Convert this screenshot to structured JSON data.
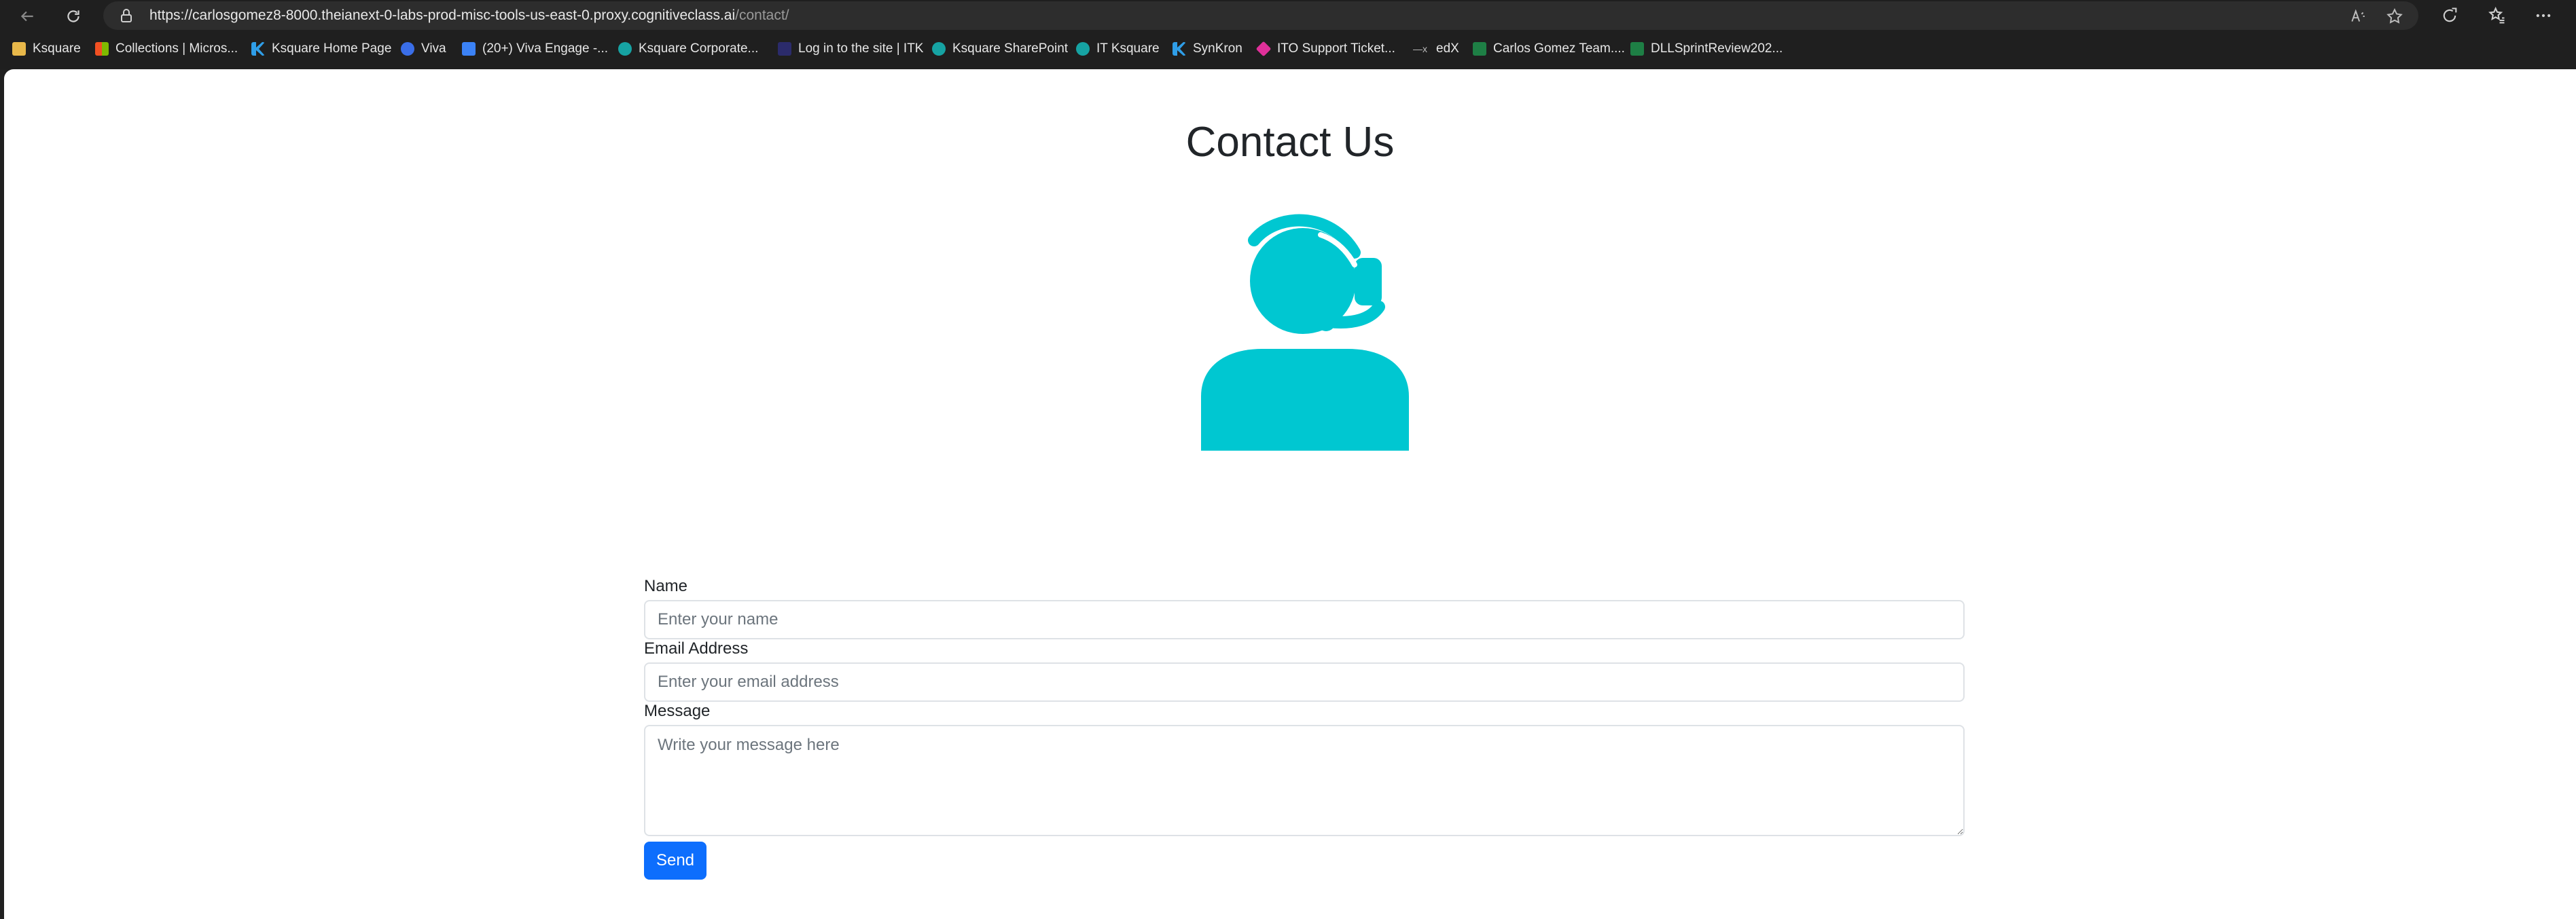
{
  "browser": {
    "url_host": "https://carlosgomez8-8000.theianext-0-labs-prod-misc-tools-us-east-0.proxy.cognitiveclass.ai",
    "url_path": "/contact/",
    "bookmarks": [
      {
        "label": "Ksquare",
        "icon": "folder-icon",
        "color": "#e8b84a"
      },
      {
        "label": "Collections | Micros...",
        "icon": "microsoft-icon",
        "color": "#f25022"
      },
      {
        "label": "Ksquare Home Page",
        "icon": "ksquare-icon",
        "color": "#2f9ee8"
      },
      {
        "label": "Viva",
        "icon": "viva-icon",
        "color": "#3a6ee8"
      },
      {
        "label": "(20+) Viva Engage -...",
        "icon": "viva-engage-icon",
        "color": "#3b82f6"
      },
      {
        "label": "Ksquare Corporate...",
        "icon": "sharepoint-icon",
        "color": "#16a3a3"
      },
      {
        "label": "Log in to the site | ITK",
        "icon": "itk-icon",
        "color": "#2b2b6b"
      },
      {
        "label": "Ksquare SharePoint",
        "icon": "sharepoint-icon",
        "color": "#16a3a3"
      },
      {
        "label": "IT Ksquare",
        "icon": "sharepoint-icon",
        "color": "#16a3a3"
      },
      {
        "label": "SynKron",
        "icon": "synkron-icon",
        "color": "#2f9ee8"
      },
      {
        "label": "ITO Support Ticket...",
        "icon": "ticket-icon",
        "color": "#e0309a"
      },
      {
        "label": "edX",
        "icon": "edx-icon",
        "color": "#bdbdbd"
      },
      {
        "label": "Carlos Gomez Team....",
        "icon": "excel-icon",
        "color": "#1e7f45"
      },
      {
        "label": "DLLSprintReview202...",
        "icon": "excel-icon",
        "color": "#1e7f45"
      }
    ]
  },
  "page": {
    "title": "Contact Us",
    "illustration_color": "#00c7d1",
    "form": {
      "name_label": "Name",
      "name_placeholder": "Enter your name",
      "email_label": "Email Address",
      "email_placeholder": "Enter your email address",
      "message_label": "Message",
      "message_placeholder": "Write your message here",
      "send_label": "Send"
    }
  }
}
